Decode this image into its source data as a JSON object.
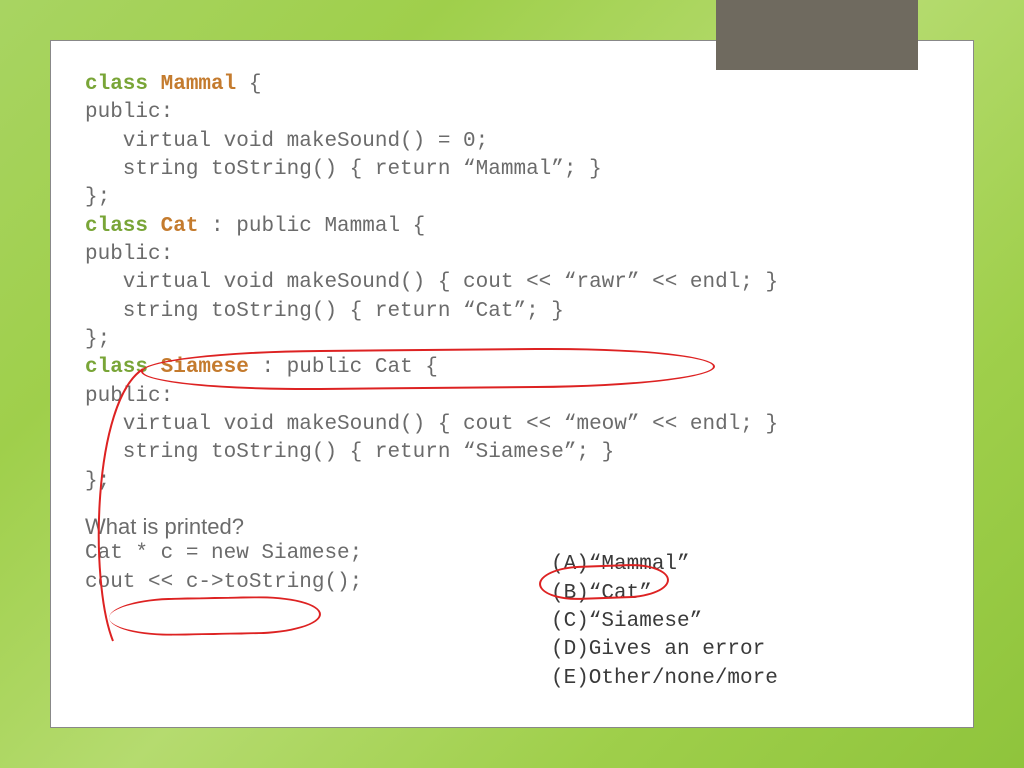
{
  "code": {
    "l1a": "class",
    "l1b": " ",
    "l1c": "Mammal",
    "l1d": " {",
    "l2": "public:",
    "l3": "   virtual void makeSound() = 0;",
    "l4": "   string toString() { return “Mammal”; }",
    "l5": "};",
    "l6a": "class",
    "l6b": " ",
    "l6c": "Cat",
    "l6d": " : public Mammal {",
    "l7": "public:",
    "l8": "   virtual void makeSound() { cout << “rawr” << endl; }",
    "l9": "   string toString() { return “Cat”; }",
    "l10": "};",
    "l11a": "class",
    "l11b": " ",
    "l11c": "Siamese",
    "l11d": " : public Cat {",
    "l12": "public:",
    "l13": "   virtual void makeSound() { cout << “meow” << endl; }",
    "l14": "   string toString() { return “Siamese”; }",
    "l15": "};"
  },
  "question": {
    "title": "What is printed?",
    "q1": "Cat * c = new Siamese;",
    "q2": "cout << c->toString();"
  },
  "options": {
    "a": "(A)“Mammal”",
    "b": "(B)“Cat”",
    "c": "(C)“Siamese”",
    "d": "(D)Gives an error",
    "e": "(E)Other/none/more"
  }
}
